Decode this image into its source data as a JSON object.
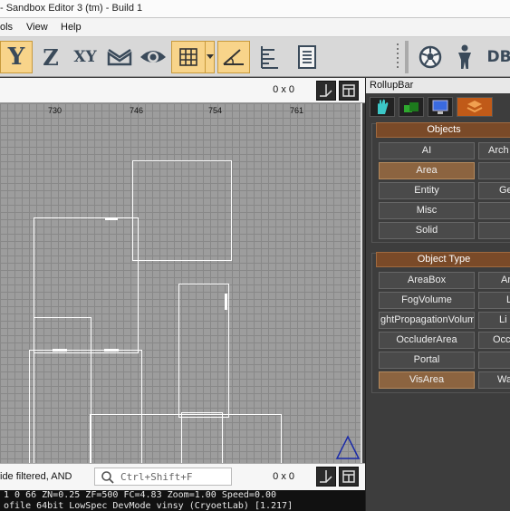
{
  "window": {
    "title": "- Sandbox Editor 3 (tm) - Build 1"
  },
  "menu": {
    "items": [
      "ols",
      "View",
      "Help"
    ]
  },
  "toolbar": {
    "buttons": [
      {
        "label": "Y",
        "icon": "axis-y-icon",
        "active": true
      },
      {
        "label": "Z",
        "icon": "axis-z-icon",
        "active": false
      },
      {
        "label": "XY",
        "icon": "axis-xy-icon",
        "active": false
      },
      {
        "icon": "terrain-snap-icon"
      },
      {
        "icon": "object-snap-icon"
      },
      {
        "icon": "grid-snap-icon",
        "active": true
      },
      {
        "icon": "angle-snap-icon",
        "active": true
      },
      {
        "icon": "ruler-icon"
      },
      {
        "icon": "notes-icon"
      },
      {
        "icon": "soccer-ball-icon"
      },
      {
        "icon": "character-icon"
      },
      {
        "label": "DB",
        "icon": "database-icon"
      }
    ]
  },
  "viewport": {
    "size_label": "0 x 0",
    "ruler": [
      "730",
      "746",
      "754",
      "761"
    ],
    "footer": {
      "filter_text": "ide filtered, AND",
      "search_placeholder": "Ctrl+Shift+F",
      "size_label": "0 x 0"
    }
  },
  "console": {
    "line1": "1  0  66 ZN=0.25 ZF=500 FC=4.83 Zoom=1.00 Speed=0.00",
    "line2": "ofile 64bit LowSpec DevMode vinsy (CryoetLab) [1.217]"
  },
  "rollup": {
    "title": "RollupBar",
    "objects_header": "Objects",
    "objects": [
      {
        "label": "AI",
        "selected": false
      },
      {
        "label": "Arch",
        "selected": false
      },
      {
        "label": "Area",
        "selected": true
      },
      {
        "label": "",
        "selected": false
      },
      {
        "label": "Entity",
        "selected": false
      },
      {
        "label": "Ge",
        "selected": false
      },
      {
        "label": "Misc",
        "selected": false
      },
      {
        "label": "",
        "selected": false
      },
      {
        "label": "Solid",
        "selected": false
      },
      {
        "label": "",
        "selected": false
      }
    ],
    "type_header": "Object Type",
    "types": [
      {
        "label": "AreaBox",
        "selected": false
      },
      {
        "label": "Ar",
        "selected": false
      },
      {
        "label": "FogVolume",
        "selected": false
      },
      {
        "label": "L",
        "selected": false
      },
      {
        "label": "ghtPropagationVolum",
        "selected": false
      },
      {
        "label": "Li",
        "selected": false
      },
      {
        "label": "OccluderArea",
        "selected": false
      },
      {
        "label": "Occ",
        "selected": false
      },
      {
        "label": "Portal",
        "selected": false
      },
      {
        "label": "",
        "selected": false
      },
      {
        "label": "VisArea",
        "selected": true
      },
      {
        "label": "Wa",
        "selected": false
      }
    ]
  },
  "colors": {
    "accent": "#f8d48a",
    "selected": "#8c6440",
    "panel_header": "#7a4a28"
  }
}
